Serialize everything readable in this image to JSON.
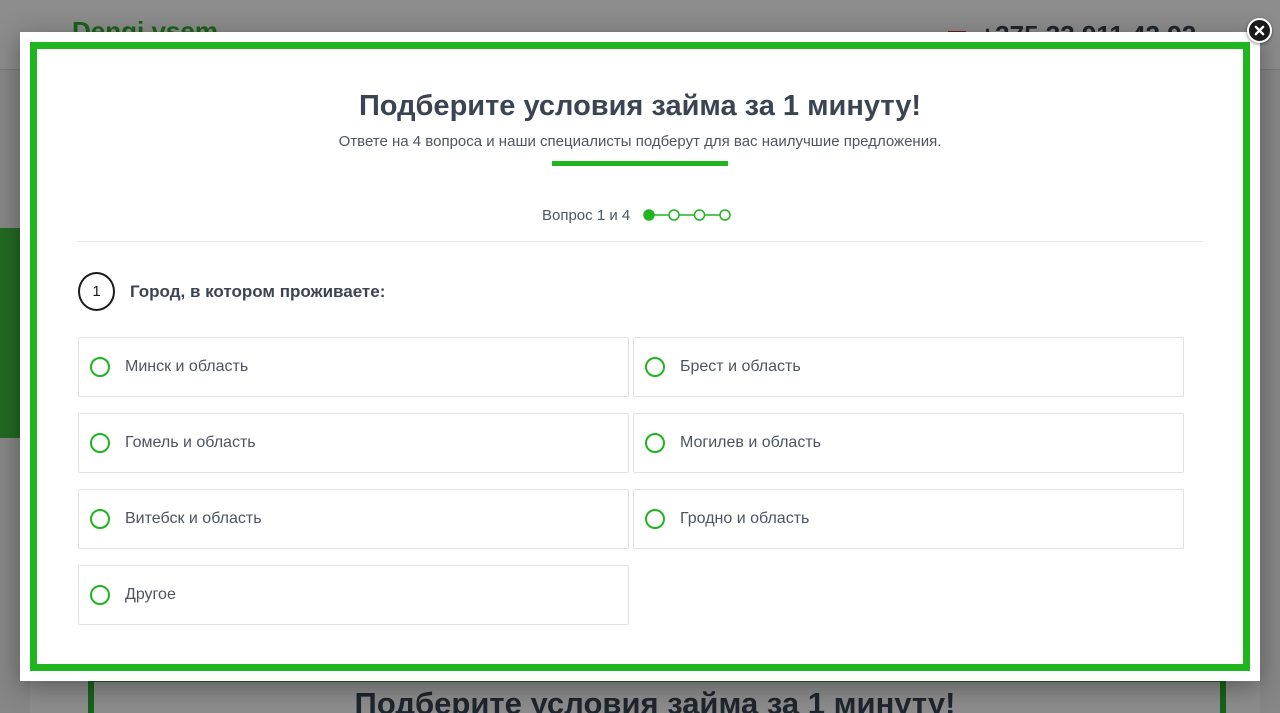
{
  "background": {
    "logo": "Dengi.vsem",
    "phone": "+375 33 911 43 92",
    "section_title": "Подберите условия займа за 1 минуту!"
  },
  "modal": {
    "title": "Подберите условия займа за 1 минуту!",
    "subtitle": "Ответе на 4 вопроса и наши специалисты подберут для вас наилучшие предложения.",
    "progress": {
      "label": "Вопрос 1 и 4",
      "current_step": 1,
      "total_steps": 4
    },
    "question": {
      "number": "1",
      "text": "Город, в котором проживаете:",
      "options": [
        {
          "label": "Минск и область"
        },
        {
          "label": "Брест и область"
        },
        {
          "label": "Гомель и область"
        },
        {
          "label": "Могилев и область"
        },
        {
          "label": "Витебск и область"
        },
        {
          "label": "Гродно и область"
        },
        {
          "label": "Другое"
        }
      ]
    }
  },
  "colors": {
    "accent": "#1eb51e",
    "text_dark": "#3a4452",
    "text_muted": "#4d5560"
  },
  "icons": {
    "close": "close-icon",
    "radio": "radio-unchecked-icon"
  }
}
